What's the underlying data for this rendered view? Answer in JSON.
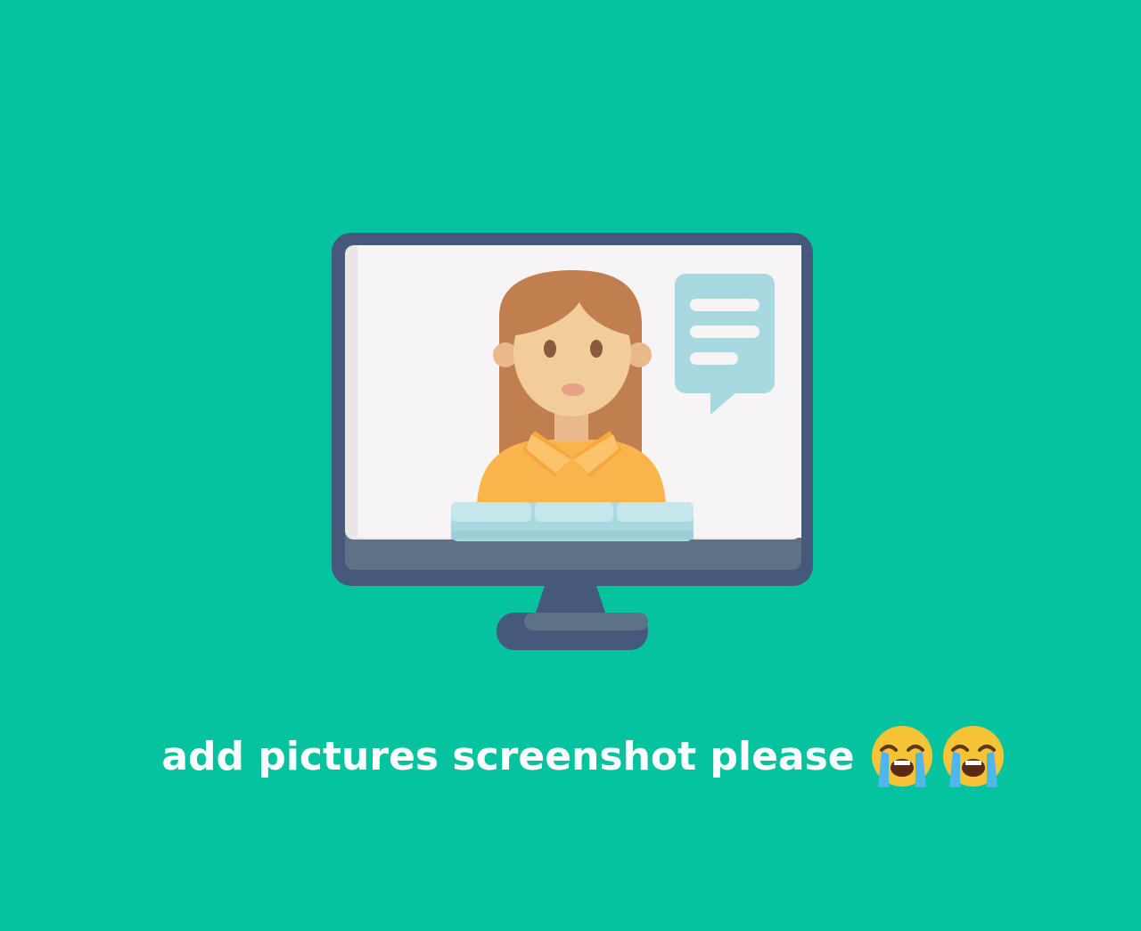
{
  "caption": {
    "text": "add pictures screenshot please",
    "emoji": [
      "crying-face",
      "crying-face"
    ]
  },
  "illustration": {
    "subject": "video-call-monitor-icon"
  },
  "colors": {
    "background": "#05c39f",
    "monitor_frame": "#46597c",
    "monitor_bezel_bottom": "#5e7287",
    "screen": "#f6f4f4",
    "hair": "#c17f4f",
    "skin": "#f1cd9c",
    "shirt": "#f9b54c",
    "speech_bubble": "#a9d9e0",
    "caption_text": "#ffffff"
  }
}
